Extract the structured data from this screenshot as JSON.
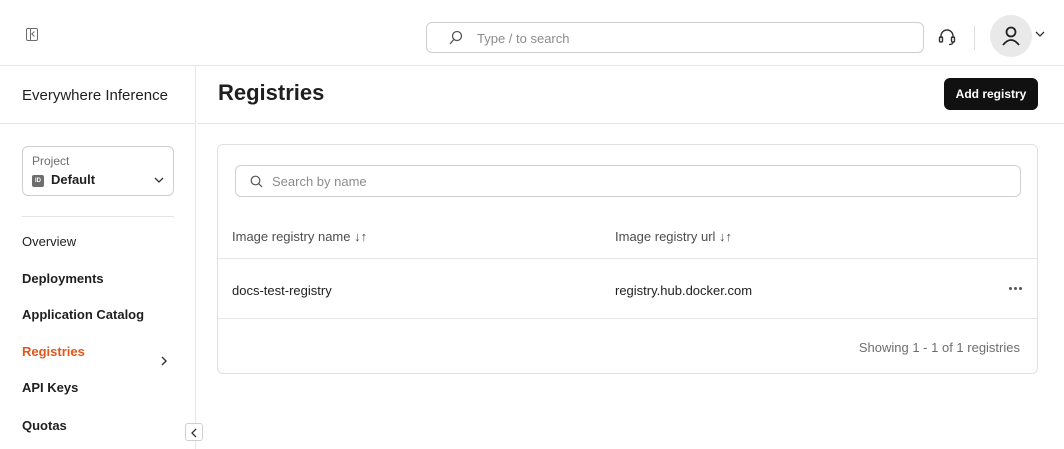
{
  "topbar": {
    "search_placeholder": "Type / to search"
  },
  "sidebar": {
    "title": "Everywhere Inference",
    "project": {
      "label": "Project",
      "badge": "ID",
      "value": "Default"
    },
    "items": [
      {
        "label": "Overview"
      },
      {
        "label": "Deployments"
      },
      {
        "label": "Application Catalog"
      },
      {
        "label": "Registries"
      },
      {
        "label": "API Keys"
      },
      {
        "label": "Quotas"
      }
    ]
  },
  "page": {
    "title": "Registries",
    "add_button": "Add registry"
  },
  "table": {
    "search_placeholder": "Search by name",
    "columns": [
      "Image registry name ↓↑",
      "Image registry url ↓↑"
    ],
    "rows": [
      {
        "name": "docs-test-registry",
        "url": "registry.hub.docker.com"
      }
    ],
    "footer": "Showing 1 - 1 of 1 registries"
  },
  "colors": {
    "accent": "#e4561b",
    "button_bg": "#111111"
  },
  "icons": [
    "sidebar-collapse-icon",
    "search-icon",
    "headset-icon",
    "user-icon",
    "chevron-down-icon",
    "chevron-right-icon",
    "chevron-left-icon",
    "more-icon"
  ]
}
